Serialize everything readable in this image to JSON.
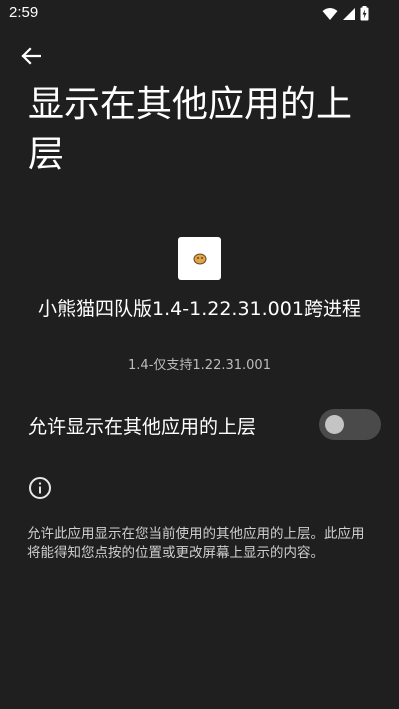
{
  "status_bar": {
    "time": "2:59",
    "icons": [
      "wifi-icon",
      "cellular-signal-icon",
      "battery-icon"
    ]
  },
  "header": {
    "back_icon": "arrow-left-icon",
    "title": "显示在其他应用的上层"
  },
  "app": {
    "icon": "app-icon",
    "name": "小熊猫四队版1.4-1.22.31.001跨进程",
    "version": "1.4-仅支持1.22.31.001"
  },
  "setting": {
    "label": "允许显示在其他应用的上层",
    "enabled": false
  },
  "info": {
    "icon": "info-icon",
    "text": "允许此应用显示在您当前使用的其他应用的上层。此应用将能得知您点按的位置或更改屏幕上显示的内容。"
  },
  "colors": {
    "background": "#1f1f1f",
    "switch_track_off": "#4a4a4a",
    "switch_thumb_off": "#c4c4c4"
  }
}
